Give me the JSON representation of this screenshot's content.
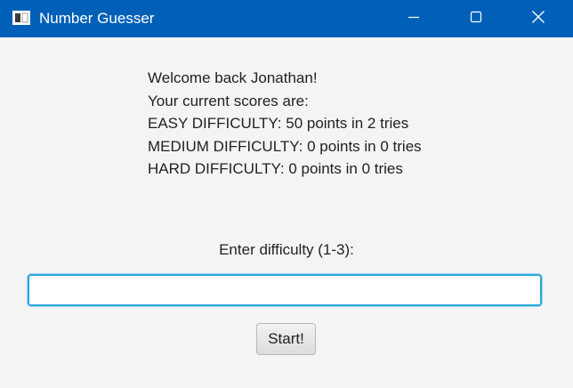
{
  "window": {
    "title": "Number Guesser",
    "controls": {
      "minimize": "minimize-icon",
      "maximize": "maximize-icon",
      "close": "close-icon"
    },
    "titlebar_color": "#0060b8"
  },
  "main": {
    "welcome": "Welcome back Jonathan!",
    "scores_heading": "Your current scores are:",
    "scores": [
      "EASY DIFFICULTY: 50 points in 2 tries",
      "MEDIUM DIFFICULTY: 0 points in 0 tries",
      "HARD DIFFICULTY: 0 points in 0 tries"
    ],
    "prompt": "Enter difficulty (1-3):",
    "difficulty_input": {
      "value": "",
      "focus_color": "#2aa7d8"
    },
    "start_label": "Start!"
  }
}
